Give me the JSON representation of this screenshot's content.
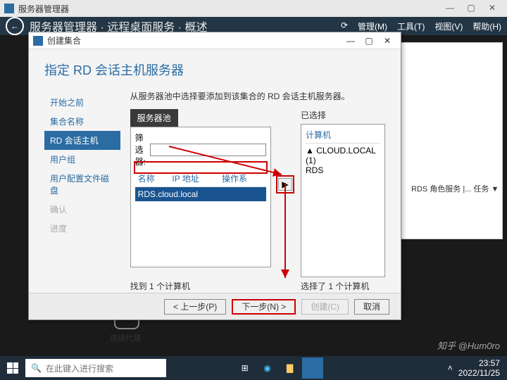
{
  "appTitle": "服务器管理器",
  "breadcrumb": "服务器管理器 · 远程桌面服务 · 概述",
  "topmenu": {
    "manage": "管理(M)",
    "tools": "工具(T)",
    "view": "视图(V)",
    "help": "帮助(H)"
  },
  "dialog": {
    "title": "创建集合",
    "heading": "指定 RD 会话主机服务器",
    "desc": "从服务器池中选择要添加到该集合的 RD 会话主机服务器。",
    "steps": {
      "before": "开始之前",
      "collection": "集合名称",
      "rdhost": "RD 会话主机",
      "usergroup": "用户组",
      "userprofile": "用户配置文件磁盘",
      "confirm": "确认",
      "progress": "进度"
    },
    "pool": {
      "tab": "服务器池",
      "filterLabel": "筛选器:",
      "col_name": "名称",
      "col_ip": "IP 地址",
      "col_os": "操作系",
      "row": "RDS.cloud.local"
    },
    "selected": {
      "label": "已选择",
      "computer": "计算机",
      "item1": "CLOUD.LOCAL (1)",
      "item2": "RDS"
    },
    "count_pool": "找到 1 个计算机",
    "count_sel": "选择了 1 个计算机",
    "buttons": {
      "prev": "< 上一步(P)",
      "next": "下一步(N) >",
      "create": "创建(C)",
      "cancel": "取消"
    }
  },
  "rightpanel": "RDS 角色服务  |... 任务 ▼",
  "bottom": {
    "broker": "连接代理"
  },
  "taskbar": {
    "search": "在此键入进行搜索",
    "time": "23:57",
    "date": "2022/11/25"
  },
  "watermark": "知乎 @Hum0ro"
}
